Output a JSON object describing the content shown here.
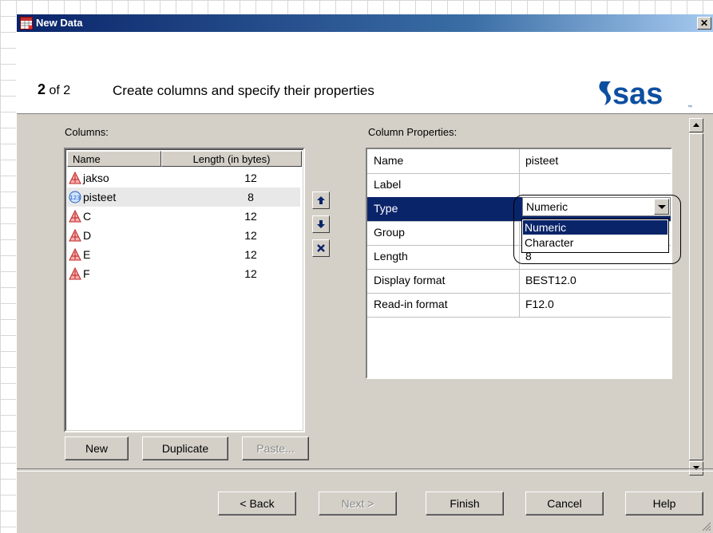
{
  "window": {
    "title": "New Data",
    "close_label": "✕"
  },
  "header": {
    "step_current": "2",
    "step_total": "of 2",
    "description": "Create columns and specify their properties",
    "logo_text": "sas"
  },
  "columns_panel": {
    "label": "Columns:",
    "headers": {
      "name": "Name",
      "length": "Length (in bytes)"
    },
    "rows": [
      {
        "name": "jakso",
        "length": "12",
        "type_icon": "character-icon"
      },
      {
        "name": "pisteet",
        "length": "8",
        "type_icon": "numeric-icon"
      },
      {
        "name": "C",
        "length": "12",
        "type_icon": "character-icon"
      },
      {
        "name": "D",
        "length": "12",
        "type_icon": "character-icon"
      },
      {
        "name": "E",
        "length": "12",
        "type_icon": "character-icon"
      },
      {
        "name": "F",
        "length": "12",
        "type_icon": "character-icon"
      }
    ],
    "selected_row": "pisteet",
    "buttons": {
      "new": "New",
      "duplicate": "Duplicate",
      "paste": "Paste..."
    }
  },
  "properties_panel": {
    "label": "Column Properties:",
    "rows": [
      {
        "key": "Name",
        "value": "pisteet"
      },
      {
        "key": "Label",
        "value": ""
      },
      {
        "key": "Type",
        "value": ""
      },
      {
        "key": "Group",
        "value": ""
      },
      {
        "key": "Length",
        "value": "8"
      },
      {
        "key": "Display format",
        "value": "BEST12.0"
      },
      {
        "key": "Read-in format",
        "value": "F12.0"
      }
    ],
    "type_combo": {
      "value": "Numeric",
      "options": [
        "Numeric",
        "Character"
      ],
      "highlighted": "Numeric"
    }
  },
  "footer": {
    "back": "< Back",
    "next": "Next >",
    "finish": "Finish",
    "cancel": "Cancel",
    "help": "Help"
  },
  "colors": {
    "title_bar": "#0a246a",
    "selection": "#0a246a",
    "dialog_bg": "#d4d0c8",
    "sas_blue": "#0d4fa0"
  }
}
